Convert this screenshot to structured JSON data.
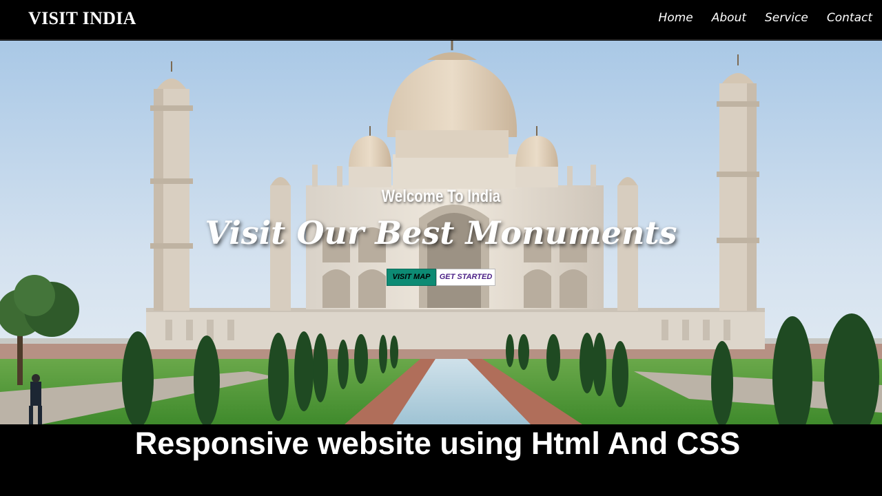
{
  "brand": {
    "logo_text": "VISIT INDIA"
  },
  "nav": {
    "items": [
      {
        "label": "Home"
      },
      {
        "label": "About"
      },
      {
        "label": "Service"
      },
      {
        "label": "Contact"
      }
    ]
  },
  "hero": {
    "welcome": "Welcome To India",
    "headline": "Visit Our Best Monuments",
    "buttons": {
      "visit_map": "VISIT MAP",
      "get_started": "GET STARTED"
    },
    "image_subject": "taj-mahal-photo"
  },
  "caption": {
    "text": "Responsive website using Html And CSS"
  },
  "colors": {
    "nav_bg": "#000000",
    "accent_green": "#0d8b74",
    "accent_purple": "#4b1f86",
    "text": "#ffffff"
  }
}
